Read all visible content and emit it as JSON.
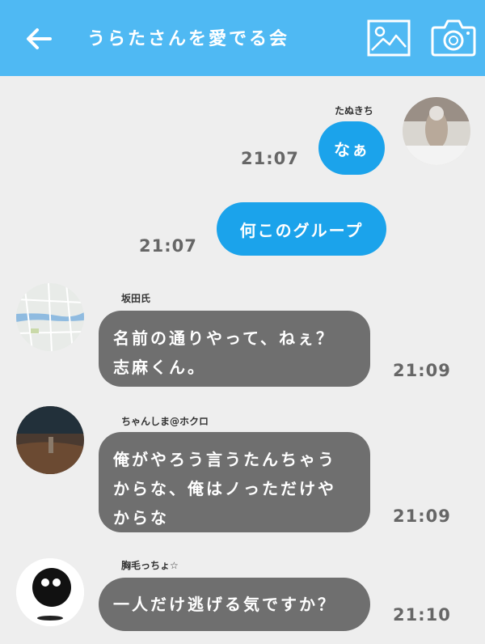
{
  "header": {
    "title": "うらたさんを愛でる会",
    "background_color": "#4fb9f3",
    "back_icon": "arrow-left-icon",
    "image_icon": "image-icon",
    "camera_icon": "camera-icon"
  },
  "messages": [
    {
      "direction": "outgoing",
      "sender": "たぬきち",
      "text": "なぁ",
      "time": "21:07"
    },
    {
      "direction": "outgoing",
      "sender": "",
      "text": "何このグループ",
      "time": "21:07"
    },
    {
      "direction": "incoming",
      "sender": "坂田氏",
      "text": "名前の通りやって、ねぇ？\n志麻くん。",
      "time": "21:09"
    },
    {
      "direction": "incoming",
      "sender": "ちゃんしま@ホクロ",
      "text": "俺がやろう言うたんちゃう\nからな、俺はノっただけや\nからな",
      "time": "21:09"
    },
    {
      "direction": "incoming",
      "sender": "胸毛っちょ☆",
      "text": "一人だけ逃げる気ですか？",
      "time": "21:10"
    }
  ],
  "colors": {
    "outgoing_bubble": "#1ba3eb",
    "incoming_bubble": "#6f6f6f",
    "background": "#eeeeee"
  }
}
